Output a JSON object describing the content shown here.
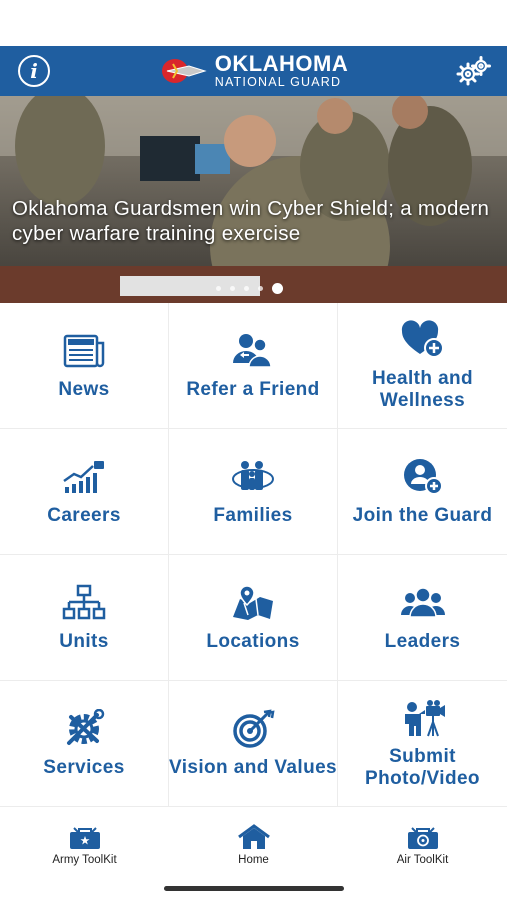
{
  "header": {
    "logo_line1": "OKLAHOMA",
    "logo_line2": "NATIONAL GUARD",
    "info_icon": "info-icon",
    "settings_icon": "gears-icon",
    "brand_color": "#1f5ea0"
  },
  "hero": {
    "title": "Oklahoma Guardsmen win Cyber Shield; a modern cyber warfare training exercise",
    "slide_count": 5,
    "active_slide": 5
  },
  "tiles": [
    {
      "label": "News",
      "icon": "newspaper-icon"
    },
    {
      "label": "Refer a Friend",
      "icon": "refer-friend-icon"
    },
    {
      "label": "Health and Wellness",
      "icon": "heart-plus-icon"
    },
    {
      "label": "Careers",
      "icon": "growth-chart-icon"
    },
    {
      "label": "Families",
      "icon": "family-icon"
    },
    {
      "label": "Join the Guard",
      "icon": "add-user-icon"
    },
    {
      "label": "Units",
      "icon": "org-chart-icon"
    },
    {
      "label": "Locations",
      "icon": "map-pin-icon"
    },
    {
      "label": "Leaders",
      "icon": "group-icon"
    },
    {
      "label": "Services",
      "icon": "tools-gear-icon"
    },
    {
      "label": "Vision and Values",
      "icon": "target-icon"
    },
    {
      "label": "Submit Photo/Video",
      "icon": "camera-person-icon"
    }
  ],
  "tabbar": {
    "items": [
      {
        "label": "Army ToolKit",
        "icon": "army-toolkit-icon"
      },
      {
        "label": "Home",
        "icon": "home-icon"
      },
      {
        "label": "Air ToolKit",
        "icon": "air-toolkit-icon"
      }
    ]
  }
}
